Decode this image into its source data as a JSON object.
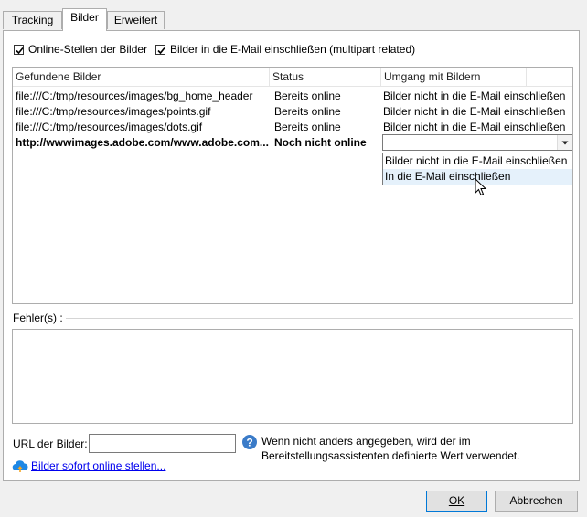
{
  "tabs": [
    {
      "label": "Tracking"
    },
    {
      "label": "Bilder"
    },
    {
      "label": "Erweitert"
    }
  ],
  "options": {
    "online_label": "Online-Stellen der Bilder",
    "online_checked": true,
    "include_label": "Bilder in die E-Mail einschließen (multipart related)",
    "include_checked": true
  },
  "grid": {
    "columns": [
      "Gefundene Bilder",
      "Status",
      "Umgang mit Bildern"
    ],
    "rows": [
      {
        "image": "file:///C:/tmp/resources/images/bg_home_header",
        "status": "Bereits online",
        "handling": "Bilder nicht in die E-Mail einschließen"
      },
      {
        "image": "file:///C:/tmp/resources/images/points.gif",
        "status": "Bereits online",
        "handling": "Bilder nicht in die E-Mail einschließen"
      },
      {
        "image": "file:///C:/tmp/resources/images/dots.gif",
        "status": "Bereits online",
        "handling": "Bilder nicht in die E-Mail einschließen"
      },
      {
        "image": "http://wwwimages.adobe.com/www.adobe.com...",
        "status": "Noch nicht online",
        "handling": ""
      }
    ]
  },
  "dropdown": {
    "options": [
      "Bilder nicht in die E-Mail einschließen",
      "In die E-Mail einschließen"
    ],
    "hovered_option": "In die E-Mail einschließen"
  },
  "errors": {
    "label": "Fehler(s) :"
  },
  "url": {
    "label": "URL der Bilder:",
    "value": "",
    "help_text_line1": "Wenn nicht anders angegeben, wird der im",
    "help_text_line2": "Bereitstellungsassistenten definierte Wert verwendet."
  },
  "publish_link": "Bilder sofort online stellen...",
  "buttons": {
    "ok": "OK",
    "cancel": "Abbrechen"
  },
  "colors": {
    "link": "#0000ee",
    "help_icon": "#3a7bc8",
    "upload_icon": "#1e88e5",
    "hover_option": "#e5f1fb"
  }
}
